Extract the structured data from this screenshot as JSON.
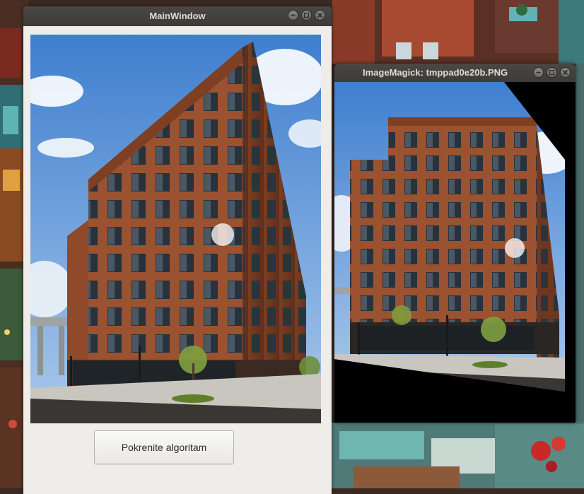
{
  "desktop": {
    "wallpaper_icon": "painted-christmas-village"
  },
  "main_window": {
    "title": "MainWindow",
    "image_content": "corten-steel-building-photo",
    "button_label": "Pokrenite algoritam",
    "controls": [
      "minimize-icon",
      "maximize-icon",
      "close-icon"
    ]
  },
  "imagemagick_window": {
    "title": "ImageMagick: tmppad0e20b.PNG",
    "image_content": "perspective-corrected-building-photo",
    "controls": [
      "minimize-icon",
      "maximize-icon",
      "close-icon"
    ]
  },
  "colors": {
    "titlebar": "#3c3b37",
    "title_text": "#dfdbd2",
    "window_bg": "#efedea",
    "steel_rust": "#8e4a2a",
    "sky": "#6aa0d8"
  }
}
